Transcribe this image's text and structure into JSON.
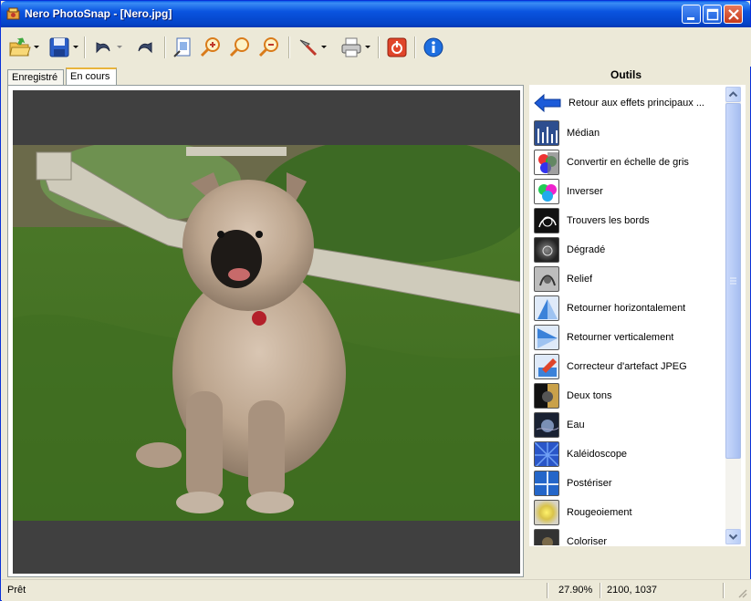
{
  "window": {
    "title": "Nero PhotoSnap - [Nero.jpg]"
  },
  "toolbar": {
    "icons": [
      "open-folder-icon",
      "save-icon",
      "undo-icon",
      "redo-icon",
      "fit-page-icon",
      "zoom-in-icon",
      "zoom-actual-icon",
      "zoom-out-icon",
      "adjust-tools-icon",
      "print-icon",
      "power-icon",
      "info-icon"
    ]
  },
  "tabs": [
    {
      "label": "Enregistré"
    },
    {
      "label": "En cours"
    }
  ],
  "tools_panel": {
    "title": "Outils",
    "back_label": "Retour aux effets principaux ...",
    "items": [
      {
        "label": "Médian",
        "icon": "median-icon"
      },
      {
        "label": "Convertir en échelle de gris",
        "icon": "grayscale-icon"
      },
      {
        "label": "Inverser",
        "icon": "invert-icon"
      },
      {
        "label": "Trouvers les bords",
        "icon": "find-edges-icon"
      },
      {
        "label": "Dégradé",
        "icon": "gradient-icon"
      },
      {
        "label": "Relief",
        "icon": "relief-icon"
      },
      {
        "label": "Retourner horizontalement",
        "icon": "flip-horizontal-icon"
      },
      {
        "label": "Retourner verticalement",
        "icon": "flip-vertical-icon"
      },
      {
        "label": "Correcteur d'artefact JPEG",
        "icon": "jpeg-artifact-icon"
      },
      {
        "label": "Deux tons",
        "icon": "duotone-icon"
      },
      {
        "label": "Eau",
        "icon": "water-icon"
      },
      {
        "label": "Kaléidoscope",
        "icon": "kaleidoscope-icon"
      },
      {
        "label": "Postériser",
        "icon": "posterize-icon"
      },
      {
        "label": "Rougeoiement",
        "icon": "glow-icon"
      },
      {
        "label": "Coloriser",
        "icon": "colorize-icon"
      }
    ]
  },
  "statusbar": {
    "status": "Prêt",
    "zoom": "27.90%",
    "dimensions": "2100, 1037"
  }
}
